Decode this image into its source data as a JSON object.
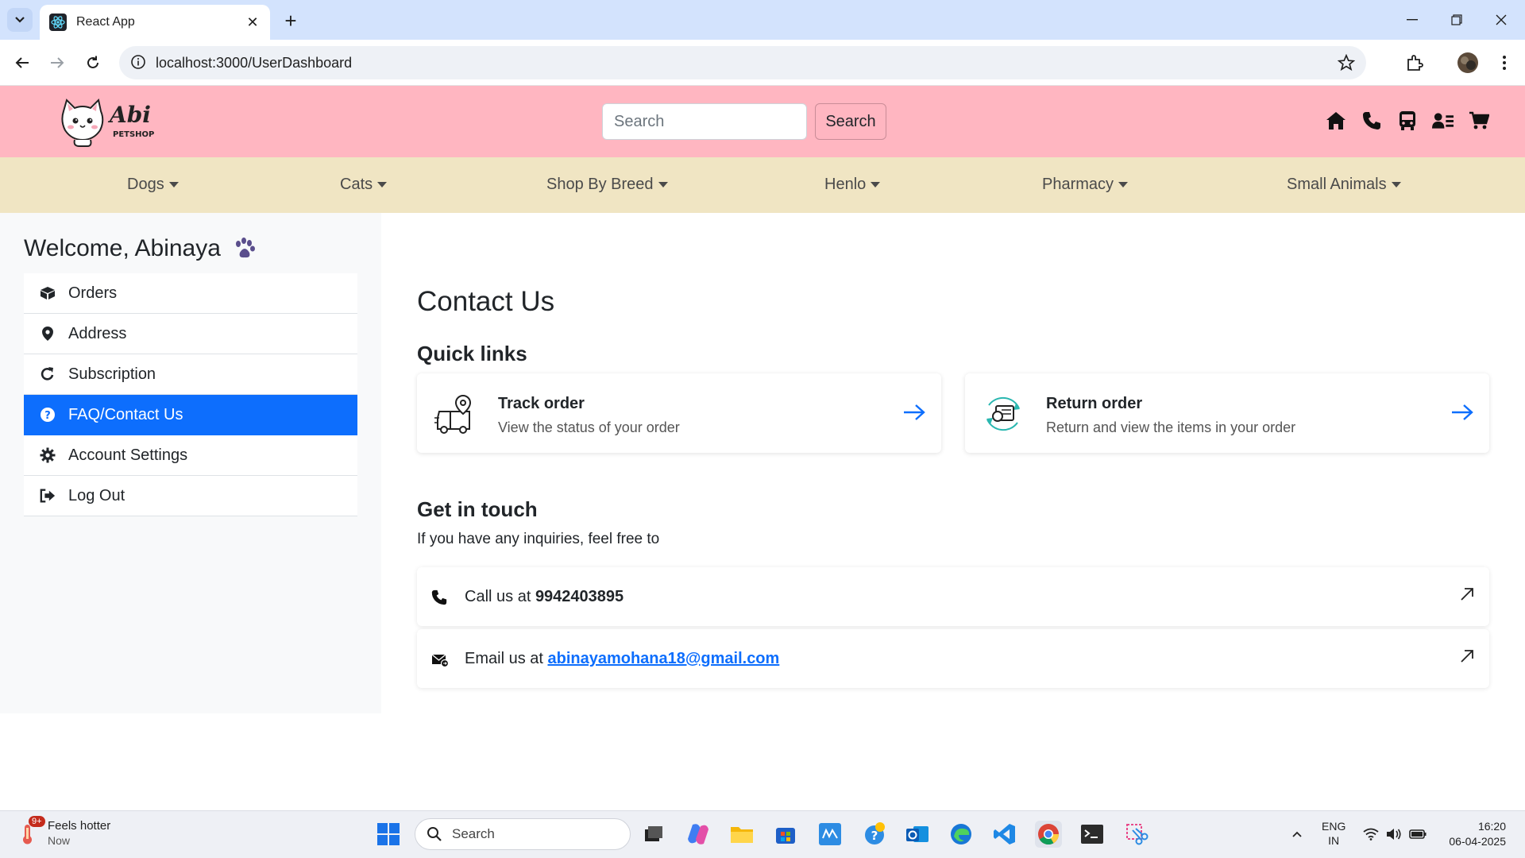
{
  "browser": {
    "tab_title": "React App",
    "url": "localhost:3000/UserDashboard"
  },
  "header": {
    "logo_text": "Abi",
    "logo_subtext": "PETSHOP",
    "search_placeholder": "Search",
    "search_button": "Search",
    "icons": [
      "home-icon",
      "phone-icon",
      "bus-icon",
      "user-list-icon",
      "cart-icon"
    ],
    "background": "#ffb6c1"
  },
  "categories": [
    {
      "label": "Dogs"
    },
    {
      "label": "Cats"
    },
    {
      "label": "Shop By Breed"
    },
    {
      "label": "Henlo"
    },
    {
      "label": "Pharmacy"
    },
    {
      "label": "Small Animals"
    }
  ],
  "sidebar": {
    "welcome": "Welcome, Abinaya",
    "items": [
      {
        "label": "Orders",
        "icon": "box-icon"
      },
      {
        "label": "Address",
        "icon": "location-pin-icon"
      },
      {
        "label": "Subscription",
        "icon": "refresh-icon"
      },
      {
        "label": "FAQ/Contact Us",
        "icon": "question-circle-icon",
        "active": true
      },
      {
        "label": "Account Settings",
        "icon": "gear-icon"
      },
      {
        "label": "Log Out",
        "icon": "logout-icon"
      }
    ],
    "active_color": "#0d6efd"
  },
  "main": {
    "title": "Contact Us",
    "quick_links_heading": "Quick links",
    "quick_links": [
      {
        "title": "Track order",
        "subtitle": "View the status of your order"
      },
      {
        "title": "Return order",
        "subtitle": "Return and view the items in your order"
      }
    ],
    "get_in_touch_heading": "Get in touch",
    "get_in_touch_text": "If you have any inquiries, feel free to",
    "call_prefix": "Call us at ",
    "phone": "9942403895",
    "email_prefix": "Email us at ",
    "email": "abinayamohana18@gmail.com"
  },
  "taskbar": {
    "weather_title": "Feels hotter",
    "weather_sub": "Now",
    "weather_badge": "9+",
    "search_placeholder": "Search",
    "lang_top": "ENG",
    "lang_bottom": "IN",
    "time": "16:20",
    "date": "06-04-2025"
  }
}
